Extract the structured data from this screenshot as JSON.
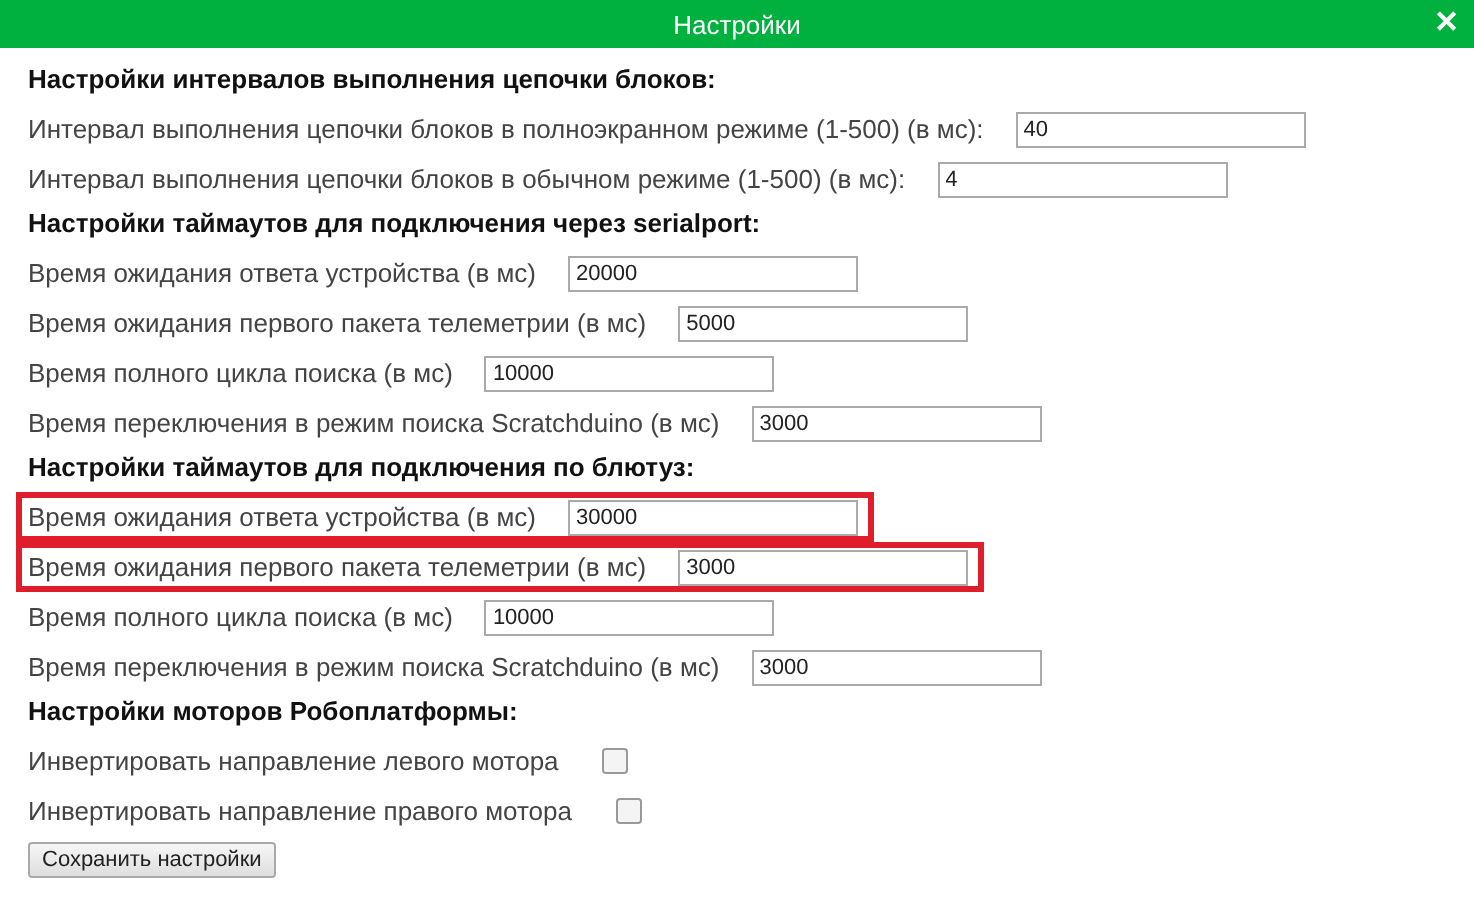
{
  "window": {
    "title": "Настройки",
    "close": "✕"
  },
  "sections": [
    {
      "heading": "Настройки интервалов выполнения цепочки блоков:",
      "items": [
        {
          "kind": "field",
          "label": "Интервал выполнения цепочки блоков в полноэкранном режиме (1-500) (в мс):",
          "value": "40",
          "highlighted": false
        },
        {
          "kind": "field",
          "label": "Интервал выполнения цепочки блоков в обычном режиме (1-500) (в мс):",
          "value": "4",
          "highlighted": false
        }
      ]
    },
    {
      "heading": "Настройки таймаутов для подключения через serialport:",
      "items": [
        {
          "kind": "field",
          "label": "Время ожидания ответа устройства (в мс)",
          "value": "20000",
          "highlighted": false
        },
        {
          "kind": "field",
          "label": "Время ожидания первого пакета телеметрии (в мс)",
          "value": "5000",
          "highlighted": false
        },
        {
          "kind": "field",
          "label": "Время полного цикла поиска (в мс)",
          "value": "10000",
          "highlighted": false
        },
        {
          "kind": "field",
          "label": "Время переключения в режим поиска Scratchduino (в мс)",
          "value": "3000",
          "highlighted": false
        }
      ]
    },
    {
      "heading": "Настройки таймаутов для подключения по блютуз:",
      "items": [
        {
          "kind": "field",
          "label": "Время ожидания ответа устройства (в мс)",
          "value": "30000",
          "highlighted": true
        },
        {
          "kind": "field",
          "label": "Время ожидания первого пакета телеметрии (в мс)",
          "value": "3000",
          "highlighted": true
        },
        {
          "kind": "field",
          "label": "Время полного цикла поиска (в мс)",
          "value": "10000",
          "highlighted": false
        },
        {
          "kind": "field",
          "label": "Время переключения в режим поиска Scratchduino (в мс)",
          "value": "3000",
          "highlighted": false
        }
      ]
    },
    {
      "heading": "Настройки моторов Робоплатформы:",
      "items": [
        {
          "kind": "checkbox",
          "label": "Инвертировать направление левого мотора",
          "checked": false,
          "highlighted": false
        },
        {
          "kind": "checkbox",
          "label": "Инвертировать направление правого мотора",
          "checked": false,
          "highlighted": false
        }
      ]
    }
  ],
  "save_button": "Сохранить настройки"
}
